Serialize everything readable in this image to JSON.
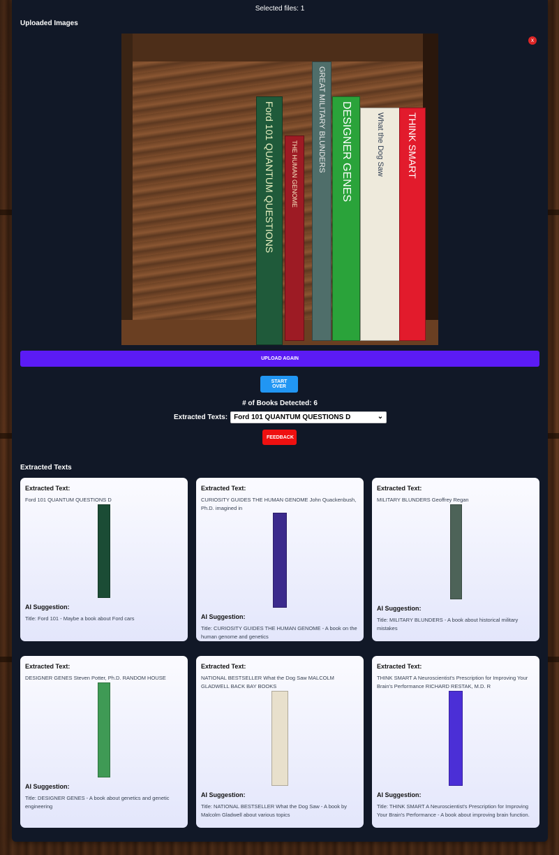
{
  "status": {
    "selected_files": "Selected files: 1"
  },
  "uploaded": {
    "heading": "Uploaded Images",
    "remove_label": "x"
  },
  "photo_books": [
    {
      "title": "Ford  101 QUANTUM QUESTIONS",
      "color": "#1f5a3a",
      "text_color": "#e8f0c0"
    },
    {
      "title": "THE HUMAN GENOME",
      "color": "#9d1b24",
      "text_color": "#f5e4c0"
    },
    {
      "title": "GREAT MILITARY BLUNDERS",
      "color": "#4f6e6a",
      "text_color": "#eaeaea"
    },
    {
      "title": "DESIGNER GENES",
      "color": "#2aa33a",
      "text_color": "#ffffff"
    },
    {
      "title": "What the Dog Saw",
      "color": "#eeeadc",
      "text_color": "#334155"
    },
    {
      "title": "THINK SMART",
      "color": "#e21b2c",
      "text_color": "#ffffff"
    }
  ],
  "actions": {
    "upload_again": "UPLOAD AGAIN",
    "start_over": "START OVER",
    "feedback": "FEEDBACK"
  },
  "summary": {
    "books_detected_label": "# of Books Detected:",
    "books_detected_value": "6",
    "extracted_label": "Extracted Texts:",
    "selected_text": "Ford 101 QUANTUM QUESTIONS D"
  },
  "results": {
    "heading": "Extracted Texts",
    "extracted_label": "Extracted Text:",
    "ai_label": "AI Suggestion:",
    "cards": [
      {
        "extracted": "Ford 101 QUANTUM QUESTIONS D",
        "suggestion": "Title: Ford 101 - Maybe a book about Ford cars",
        "spine_color": "#1b4c35"
      },
      {
        "extracted": "CURIOSITY GUIDES THE HUMAN GENOME John Quackenbush, Ph.D. imagined in",
        "suggestion": "Title: CURIOSITY GUIDES THE HUMAN GENOME - A book on the human genome and genetics",
        "spine_color": "#3b2a8c"
      },
      {
        "extracted": "MILITARY BLUNDERS Geoffrey Regan",
        "suggestion": "Title: MILITARY BLUNDERS - A book about historical military mistakes",
        "spine_color": "#4d6358"
      },
      {
        "extracted": "DESIGNER GENES Steven Potter, Ph.D. RANDOM HOUSE",
        "suggestion": "Title: DESIGNER GENES - A book about genetics and genetic engineering",
        "spine_color": "#3f9a55"
      },
      {
        "extracted": "NATIONAL BESTSELLER What the Dog Saw MALCOLM GLADWELL BACK BAY BOOKS",
        "suggestion": "Title: NATIONAL BESTSELLER What the Dog Saw - A book by Malcolm Gladwell about various topics",
        "spine_color": "#e8e0cc"
      },
      {
        "extracted": "THINK SMART A Neuroscientist's Prescription for Improving Your Brain's Performance RICHARD RESTAK, M.D. R",
        "suggestion": "Title: THINK SMART A Neuroscientist's Prescription for Improving Your Brain's Performance - A book about improving brain function.",
        "spine_color": "#4b2fd6"
      }
    ]
  }
}
